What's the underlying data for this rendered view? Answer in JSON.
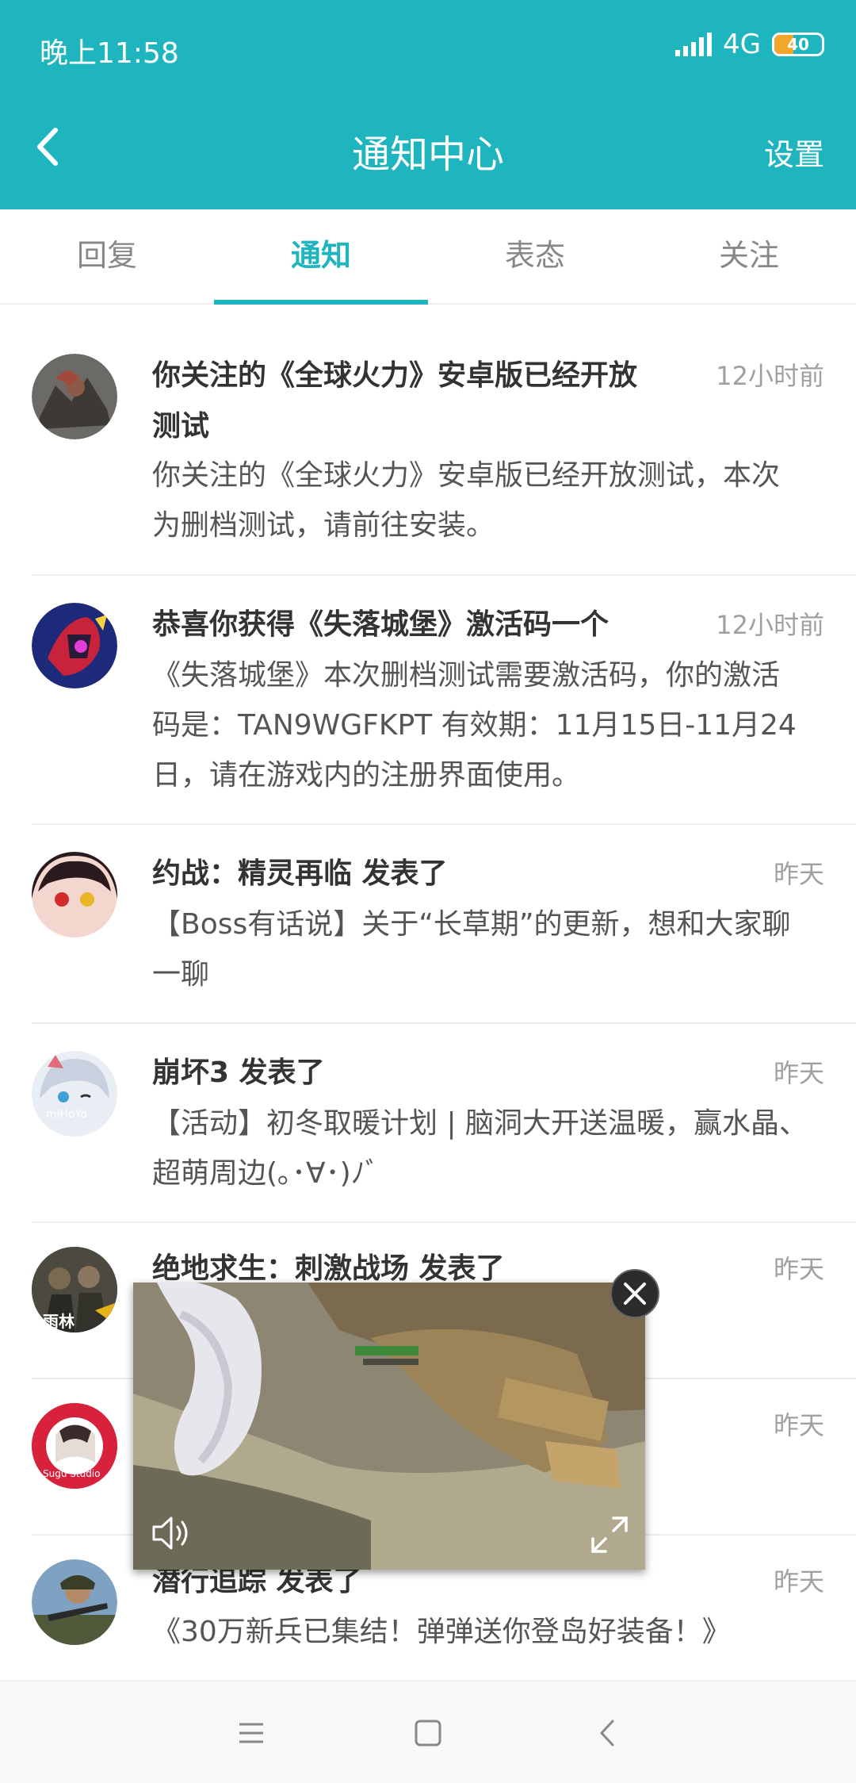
{
  "status_bar": {
    "time": "晚上11:58",
    "network": "4G",
    "battery": "40"
  },
  "header": {
    "title": "通知中心",
    "settings_label": "设置"
  },
  "tabs": [
    {
      "label": "回复",
      "active": false
    },
    {
      "label": "通知",
      "active": true
    },
    {
      "label": "表态",
      "active": false
    },
    {
      "label": "关注",
      "active": false
    }
  ],
  "notifications": [
    {
      "title_line1": "你关注的《全球火力》安卓版已经开放",
      "title_line2": "测试",
      "time": "12小时前",
      "body_line1": "你关注的《全球火力》安卓版已经开放测试，本次",
      "body_line2": "为删档测试，请前往安装。"
    },
    {
      "title": "恭喜你获得《失落城堡》激活码一个",
      "time": "12小时前",
      "body_line1": "《失落城堡》本次删档测试需要激活码，你的激活",
      "body_line2": "码是：TAN9WGFKPT 有效期：11月15日-11月24",
      "body_line3": "日，请在游戏内的注册界面使用。"
    },
    {
      "title": "约战：精灵再临 发表了",
      "time": "昨天",
      "body_line1": "【Boss有话说】关于“长草期”的更新，想和大家聊",
      "body_line2": "一聊"
    },
    {
      "title": "崩坏3 发表了",
      "time": "昨天",
      "body_line1": "【活动】初冬取暖计划 | 脑洞大开送温暖，赢水晶、",
      "body_line2": "超萌周边(｡･∀･)ﾉﾞ",
      "avatar_text": "miHoYo"
    },
    {
      "title": "绝地求生：刺激战场 发表了",
      "time": "昨天",
      "avatar_text": "雨林"
    },
    {
      "title": "",
      "time": "昨天",
      "avatar_text": "Sugu Studio"
    },
    {
      "title": "潜行追踪 发表了",
      "time": "昨天",
      "body_line1": "《30万新兵已集结！弹弹送你登岛好装备！》"
    }
  ],
  "colors": {
    "accent": "#1fb5bf"
  }
}
